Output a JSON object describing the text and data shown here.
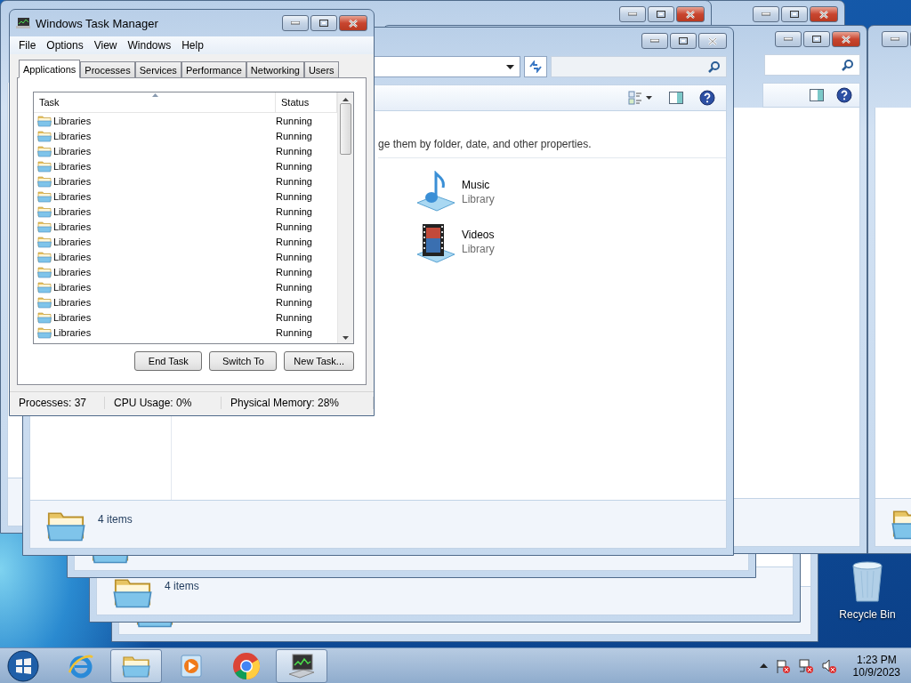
{
  "task_manager": {
    "title": "Windows Task Manager",
    "menu": [
      "File",
      "Options",
      "View",
      "Windows",
      "Help"
    ],
    "tabs": [
      {
        "label": "Applications",
        "selected": true
      },
      {
        "label": "Processes",
        "selected": false
      },
      {
        "label": "Services",
        "selected": false
      },
      {
        "label": "Performance",
        "selected": false
      },
      {
        "label": "Networking",
        "selected": false
      },
      {
        "label": "Users",
        "selected": false
      }
    ],
    "columns": [
      "Task",
      "Status"
    ],
    "rows": [
      {
        "task": "Libraries",
        "status": "Running"
      },
      {
        "task": "Libraries",
        "status": "Running"
      },
      {
        "task": "Libraries",
        "status": "Running"
      },
      {
        "task": "Libraries",
        "status": "Running"
      },
      {
        "task": "Libraries",
        "status": "Running"
      },
      {
        "task": "Libraries",
        "status": "Running"
      },
      {
        "task": "Libraries",
        "status": "Running"
      },
      {
        "task": "Libraries",
        "status": "Running"
      },
      {
        "task": "Libraries",
        "status": "Running"
      },
      {
        "task": "Libraries",
        "status": "Running"
      },
      {
        "task": "Libraries",
        "status": "Running"
      },
      {
        "task": "Libraries",
        "status": "Running"
      },
      {
        "task": "Libraries",
        "status": "Running"
      },
      {
        "task": "Libraries",
        "status": "Running"
      },
      {
        "task": "Libraries",
        "status": "Running"
      }
    ],
    "buttons": [
      "End Task",
      "Switch To",
      "New Task..."
    ],
    "status_bar": [
      "Processes: 37",
      "CPU Usage: 0%",
      "Physical Memory: 28%"
    ]
  },
  "explorer": {
    "description": "ge them by folder, date, and other properties.",
    "libraries": [
      {
        "kind": "music",
        "name": "Music",
        "type": "Library"
      },
      {
        "kind": "videos",
        "name": "Videos",
        "type": "Library"
      }
    ],
    "status": "4 items"
  },
  "background_windows": [
    {
      "status": "4 items"
    }
  ],
  "desktop_icons": [
    {
      "label": "Recycle Bin"
    }
  ],
  "taskbar": {
    "apps": [
      {
        "kind": "browser",
        "open": false
      },
      {
        "kind": "folder",
        "open": true
      },
      {
        "kind": "media",
        "open": false
      },
      {
        "kind": "chrome",
        "open": false
      },
      {
        "kind": "task-manager",
        "open": true
      }
    ],
    "clock": {
      "time": "1:23 PM",
      "date": "10/9/2023"
    }
  }
}
